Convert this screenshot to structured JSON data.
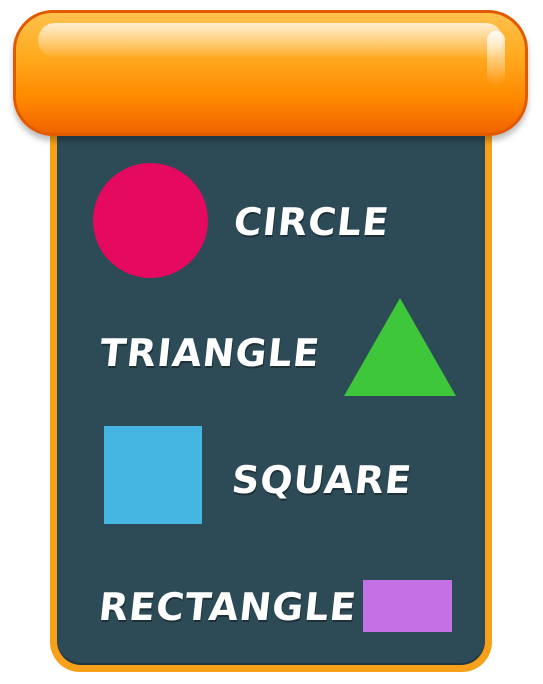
{
  "colors": {
    "header": "#ff9500",
    "board_border": "#f7a11a",
    "board_background": "#2d4a57",
    "label_text": "#ffffff"
  },
  "shapes": [
    {
      "name": "circle",
      "label": "CIRCLE",
      "color": "#e5095f"
    },
    {
      "name": "triangle",
      "label": "TRIANGLE",
      "color": "#3fc73c"
    },
    {
      "name": "square",
      "label": "SQUARE",
      "color": "#45b5e1"
    },
    {
      "name": "rectangle",
      "label": "RECTANGLE",
      "color": "#c471e6"
    }
  ]
}
